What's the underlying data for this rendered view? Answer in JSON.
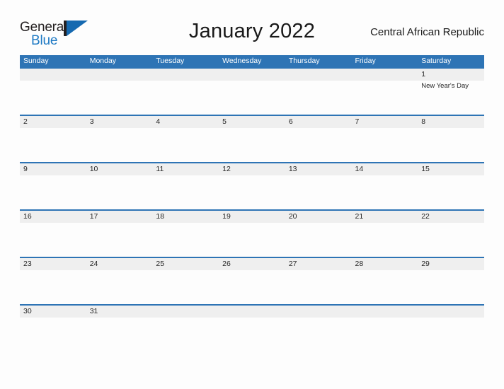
{
  "brand": {
    "word_one": "General",
    "word_two": "Blue",
    "mark": "triangle-logo-icon",
    "color_dark": "#231f20",
    "color_blue": "#1f7ac4"
  },
  "header": {
    "title": "January 2022",
    "locale": "Central African Republic"
  },
  "theme": {
    "header_blue": "#2e74b5",
    "band_gray": "#efefef",
    "page_bg": "#fdfdfd",
    "text": "#262626"
  },
  "calendar": {
    "day_headers": [
      "Sunday",
      "Monday",
      "Tuesday",
      "Wednesday",
      "Thursday",
      "Friday",
      "Saturday"
    ],
    "weeks": [
      {
        "cells": [
          {
            "day": "",
            "event": ""
          },
          {
            "day": "",
            "event": ""
          },
          {
            "day": "",
            "event": ""
          },
          {
            "day": "",
            "event": ""
          },
          {
            "day": "",
            "event": ""
          },
          {
            "day": "",
            "event": ""
          },
          {
            "day": "1",
            "event": "New Year's Day"
          }
        ]
      },
      {
        "cells": [
          {
            "day": "2",
            "event": ""
          },
          {
            "day": "3",
            "event": ""
          },
          {
            "day": "4",
            "event": ""
          },
          {
            "day": "5",
            "event": ""
          },
          {
            "day": "6",
            "event": ""
          },
          {
            "day": "7",
            "event": ""
          },
          {
            "day": "8",
            "event": ""
          }
        ]
      },
      {
        "cells": [
          {
            "day": "9",
            "event": ""
          },
          {
            "day": "10",
            "event": ""
          },
          {
            "day": "11",
            "event": ""
          },
          {
            "day": "12",
            "event": ""
          },
          {
            "day": "13",
            "event": ""
          },
          {
            "day": "14",
            "event": ""
          },
          {
            "day": "15",
            "event": ""
          }
        ]
      },
      {
        "cells": [
          {
            "day": "16",
            "event": ""
          },
          {
            "day": "17",
            "event": ""
          },
          {
            "day": "18",
            "event": ""
          },
          {
            "day": "19",
            "event": ""
          },
          {
            "day": "20",
            "event": ""
          },
          {
            "day": "21",
            "event": ""
          },
          {
            "day": "22",
            "event": ""
          }
        ]
      },
      {
        "cells": [
          {
            "day": "23",
            "event": ""
          },
          {
            "day": "24",
            "event": ""
          },
          {
            "day": "25",
            "event": ""
          },
          {
            "day": "26",
            "event": ""
          },
          {
            "day": "27",
            "event": ""
          },
          {
            "day": "28",
            "event": ""
          },
          {
            "day": "29",
            "event": ""
          }
        ]
      },
      {
        "cells": [
          {
            "day": "30",
            "event": ""
          },
          {
            "day": "31",
            "event": ""
          },
          {
            "day": "",
            "event": ""
          },
          {
            "day": "",
            "event": ""
          },
          {
            "day": "",
            "event": ""
          },
          {
            "day": "",
            "event": ""
          },
          {
            "day": "",
            "event": ""
          }
        ]
      }
    ]
  }
}
